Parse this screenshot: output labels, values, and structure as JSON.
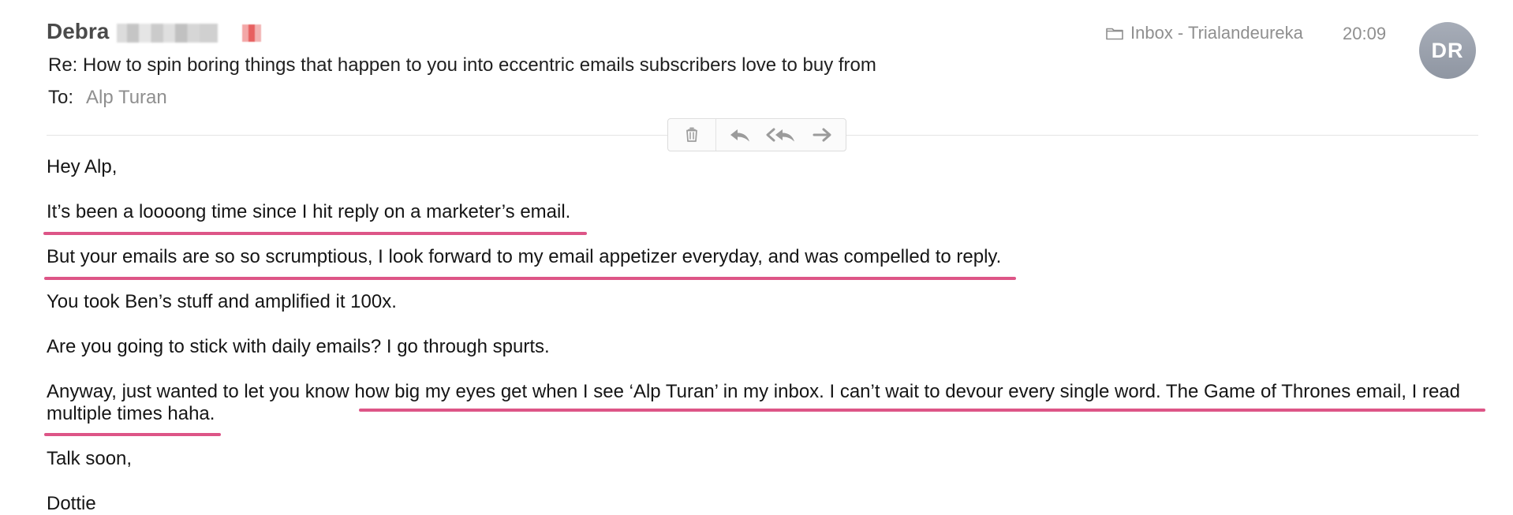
{
  "header": {
    "sender_name": "Debra",
    "subject": "Re: How to spin boring things that happen to you into eccentric emails subscribers love to buy from",
    "to_label": "To:",
    "recipient": "Alp Turan",
    "mailbox": "Inbox - Trialandeureka",
    "time": "20:09",
    "avatar_initials": "DR"
  },
  "toolbar": {
    "trash_icon": "trash-icon",
    "reply_icon": "reply-icon",
    "reply_all_icon": "reply-all-icon",
    "forward_icon": "forward-icon"
  },
  "body": {
    "greeting": "Hey Alp,",
    "p1": "It’s been a loooong time since I hit reply on a marketer’s email.",
    "p2": "But your emails are so so scrumptious, I look forward to my email appetizer everyday, and was compelled to reply.",
    "p3": "You took Ben’s stuff and amplified it 100x.",
    "p4": "Are you going to stick with daily emails? I go through spurts.",
    "p5": "Anyway, just wanted to let you know how big my eyes get when I see ‘Alp Turan’ in my inbox. I can’t wait to devour every single word. The Game of Thrones email, I read multiple times haha.",
    "closing": "Talk soon,",
    "signature": "Dottie"
  },
  "colors": {
    "highlight_underline": "#dd5587",
    "avatar": "#9aa1ad",
    "muted_text": "#8f8f8f"
  }
}
